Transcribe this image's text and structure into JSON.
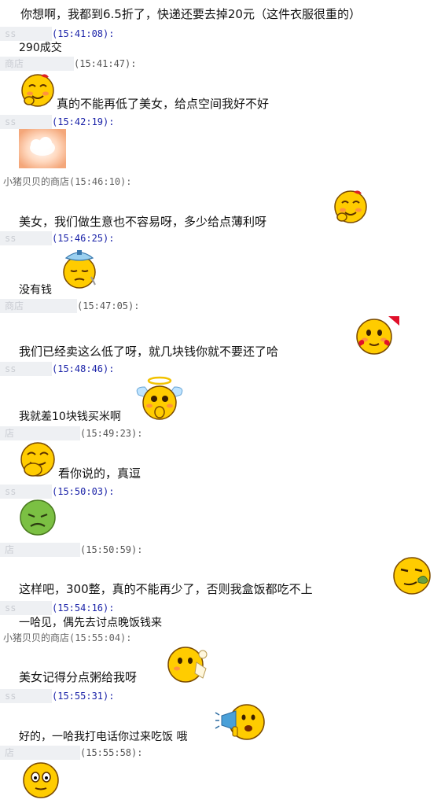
{
  "top_message": "你想啊，我都到6.5折了，快递还要去掉20元（这件衣服很重的）",
  "messages": [
    {
      "side": "me",
      "name": "ss",
      "time": "(15:41:08):",
      "text": "290成交"
    },
    {
      "side": "shop",
      "name": "商店",
      "time": "(15:41:47):",
      "text": "真的不能再低了美女，给点空间我好不好",
      "emoji": "giggle-icon"
    },
    {
      "side": "me",
      "name": "ss",
      "time": "(15:42:19):",
      "text": "",
      "emoji": "cloud-sticker-icon"
    },
    {
      "side": "shop",
      "name": "小猪贝贝的商店",
      "time": "(15:46:10):",
      "text": "美女，我们做生意也不容易呀，多少给点薄利呀",
      "emoji": "giggle-icon"
    },
    {
      "side": "me",
      "name": "ss",
      "time": "(15:46:25):",
      "text": "没有钱",
      "emoji": "ice-pack-sick-icon"
    },
    {
      "side": "shop",
      "name": "商店",
      "time": "(15:47:05):",
      "text": "我们已经卖这么低了呀，就几块钱你就不要还了哈",
      "emoji": "heart-smile-icon"
    },
    {
      "side": "me",
      "name": "ss",
      "time": "(15:48:46):",
      "text": "我就差10块钱买米啊",
      "emoji": "angel-icon"
    },
    {
      "side": "shop",
      "name": "店",
      "time": "(15:49:23):",
      "text": "看你说的，真逗",
      "emoji": "laugh-cover-mouth-icon"
    },
    {
      "side": "me",
      "name": "ss",
      "time": "(15:50:03):",
      "text": "",
      "emoji": "sick-green-icon"
    },
    {
      "side": "shop",
      "name": "店",
      "time": "(15:50:59):",
      "text": "这样吧，300整，真的不能再少了，否则我盒饭都吃不上",
      "emoji": "cigar-smirk-icon"
    },
    {
      "side": "me",
      "name": "ss",
      "time": "(15:54:16):",
      "text": "一哈见，偶先去讨点晚饭钱来"
    },
    {
      "side": "shop",
      "name": "小猪贝贝的商店",
      "time": "(15:55:04):",
      "text": "美女记得分点粥给我呀",
      "emoji": "eating-icon"
    },
    {
      "side": "me",
      "name": "ss",
      "time": "(15:55:31):",
      "text": "好的，一哈我打电话你过来吃饭 哦",
      "emoji": "megaphone-icon"
    },
    {
      "side": "shop",
      "name": "店",
      "time": "(15:55:58):",
      "text": "",
      "emoji": "surprised-icon"
    }
  ],
  "colors": {
    "face_yellow": "#ffcc00",
    "face_outline": "#7a4a00",
    "blush": "#ff7a55",
    "sick_green": "#7bc043",
    "my_timestamp": "#1a22a8",
    "name_mask": "#eef0f3"
  }
}
